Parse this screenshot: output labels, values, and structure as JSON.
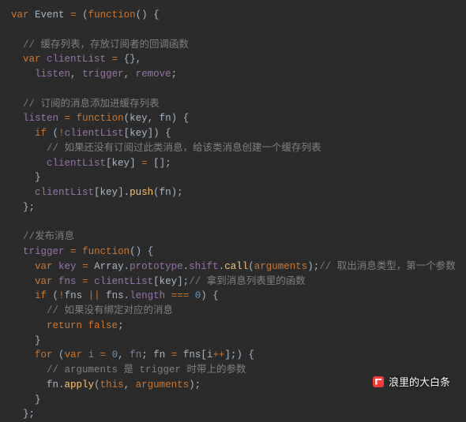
{
  "code": {
    "l1": {
      "kw1": "var",
      "nm": "Event",
      "op": "=",
      "par1": "(",
      "kw2": "function",
      "par2": "()",
      "brk": "{"
    },
    "l2": {
      "cmt": "// 缓存列表，存放订阅者的回调函数"
    },
    "l3": {
      "kw": "var",
      "nm": "clientList",
      "op": "=",
      "brc": "{}",
      "comma": ","
    },
    "l4": {
      "n1": "listen",
      "c1": ",",
      "n2": "trigger",
      "c2": ",",
      "n3": "remove",
      "semi": ";"
    },
    "l5": {
      "cmt": "// 订阅的消息添加进缓存列表"
    },
    "l6": {
      "nm": "listen",
      "op": "=",
      "kw": "function",
      "par": "(",
      "p1": "key",
      "c": ",",
      "p2": "fn",
      "par2": ")",
      "brk": "{"
    },
    "l7": {
      "kw": "if",
      "par": "(",
      "not": "!",
      "nm": "clientList",
      "b1": "[",
      "arg": "key",
      "b2": "]",
      "par2": ")",
      "brk": "{"
    },
    "l8": {
      "cmt": "// 如果还没有订阅过此类消息，给该类消息创建一个缓存列表"
    },
    "l9": {
      "nm": "clientList",
      "b1": "[",
      "arg": "key",
      "b2": "]",
      "op": "=",
      "arr": "[]",
      "semi": ";"
    },
    "l10": {
      "brk": "}"
    },
    "l11": {
      "nm": "clientList",
      "b1": "[",
      "arg": "key",
      "b2": "].",
      "fn": "push",
      "par": "(",
      "arg2": "fn",
      "par2": ")",
      "semi": ";"
    },
    "l12": {
      "brk": "};"
    },
    "l13": {
      "cmt": "//发布消息"
    },
    "l14": {
      "nm": "trigger",
      "op": "=",
      "kw": "function",
      "par": "()",
      "brk": "{"
    },
    "l15": {
      "kw": "var",
      "nm": "key",
      "op": "=",
      "obj": "Array",
      "d1": ".",
      "p1": "prototype",
      "d2": ".",
      "p2": "shift",
      "d3": ".",
      "fn": "call",
      "par": "(",
      "arg": "arguments",
      "par2": ")",
      "semi": ";",
      "cmt": "// 取出消息类型，第一个参数"
    },
    "l16": {
      "kw": "var",
      "nm": "fns",
      "op": "=",
      "obj": "clientList",
      "b1": "[",
      "arg": "key",
      "b2": "]",
      "semi": ";",
      "cmt": "// 拿到消息列表里的函数"
    },
    "l17": {
      "kw": "if",
      "par": "(",
      "not": "!",
      "nm": "fns",
      "or": "||",
      "nm2": "fns",
      "d": ".",
      "p": "length",
      "eq": "===",
      "num": "0",
      "par2": ")",
      "brk": "{"
    },
    "l18": {
      "cmt": "// 如果没有绑定对应的消息"
    },
    "l19": {
      "kw": "return",
      "val": "false",
      "semi": ";"
    },
    "l20": {
      "brk": "}"
    },
    "l21": {
      "kw": "for",
      "par": "(",
      "kw2": "var",
      "nm": "i",
      "op": "=",
      "num": "0",
      "c1": ",",
      "nm2": "fn",
      "semi1": ";",
      "nm3": "fn",
      "op2": "=",
      "nm4": "fns",
      "b1": "[",
      "nm5": "i",
      "inc": "++",
      "b2": "]",
      "semi2": ";",
      "par2": ")",
      "brk": "{"
    },
    "l22": {
      "cmt": "// arguments 是 trigger 时带上的参数"
    },
    "l23": {
      "nm": "fn",
      "d": ".",
      "fn": "apply",
      "par": "(",
      "this": "this",
      "c": ",",
      "arg": "arguments",
      "par2": ")",
      "semi": ";"
    },
    "l24": {
      "brk": "}"
    },
    "l25": {
      "brk": "};"
    }
  },
  "watermark": {
    "text": "浪里的大白条"
  }
}
